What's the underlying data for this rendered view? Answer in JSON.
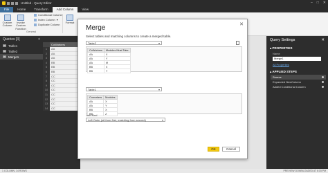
{
  "window": {
    "title": "Untitled - Query Editor",
    "controls": [
      "–",
      "□",
      "✕"
    ]
  },
  "tabs": [
    "File",
    "Home",
    "Transform",
    "Add Column",
    "View"
  ],
  "ribbon": {
    "custom_column": "Custom Column",
    "invoke_custom_function": "Invoke Custom Function",
    "conditional_column": "Conditional Column",
    "index_column": "Index Column",
    "duplicate_column": "Duplicate Column",
    "format": "Format",
    "group_label": "General"
  },
  "queries": {
    "header": "Queries [3]",
    "collapse": "<",
    "items": [
      "Table1",
      "Table2",
      "Merge1"
    ]
  },
  "grid": {
    "column_header": "CoWorkers",
    "rows": [
      {
        "n": "1",
        "v": "AA"
      },
      {
        "n": "2",
        "v": "AA"
      },
      {
        "n": "3",
        "v": "AA"
      },
      {
        "n": "4",
        "v": "BB"
      },
      {
        "n": "5",
        "v": "BB"
      },
      {
        "n": "6",
        "v": "BB"
      },
      {
        "n": "7",
        "v": "CC"
      },
      {
        "n": "8",
        "v": "CC"
      },
      {
        "n": "9",
        "v": "CC"
      },
      {
        "n": "10",
        "v": "CC"
      },
      {
        "n": "11",
        "v": "CC"
      },
      {
        "n": "12",
        "v": "CC"
      },
      {
        "n": "13",
        "v": "CC"
      },
      {
        "n": "14",
        "v": "CC"
      }
    ]
  },
  "settings": {
    "title": "Query Settings",
    "close": "✕",
    "properties_label": "PROPERTIES",
    "name_label": "Name",
    "name_value": "Merge1",
    "all_properties": "All Properties",
    "applied_steps_label": "APPLIED STEPS",
    "steps": [
      "Source",
      "Expanded NewColumn",
      "Added Conditional Column"
    ]
  },
  "status": {
    "left": "1 COLUMN, 14 ROWS",
    "right": "PREVIEW DOWNLOADED AT 6:15 PM"
  },
  "dialog": {
    "title": "Merge",
    "close": "✕",
    "description": "Select tables and matching columns to create a merged table.",
    "table1_select": "Table2",
    "table1": {
      "headers": [
        "CoWorkers",
        "Modules Must Take"
      ],
      "rows": [
        [
          "AA",
          "X"
        ],
        [
          "AA",
          "Y"
        ],
        [
          "AA",
          "M"
        ],
        [
          "BB",
          "X"
        ],
        [
          "BB",
          "Y"
        ]
      ]
    },
    "table2_select": "Table1",
    "table2": {
      "headers": [
        "Coworkers",
        "Modules"
      ],
      "rows": [
        [
          "AA",
          "X"
        ],
        [
          "AA",
          "Y"
        ],
        [
          "BB",
          "X"
        ],
        [
          "BB",
          "Z"
        ]
      ]
    },
    "join_kind_label": "Join Kind",
    "join_kind_value": "Left Outer (all from first, matching from second)",
    "ok": "OK",
    "cancel": "Cancel"
  },
  "colors": {
    "accent": "#f2c811",
    "file_tab": "#3c6e9c",
    "dark_pane": "#2d2d2d"
  }
}
